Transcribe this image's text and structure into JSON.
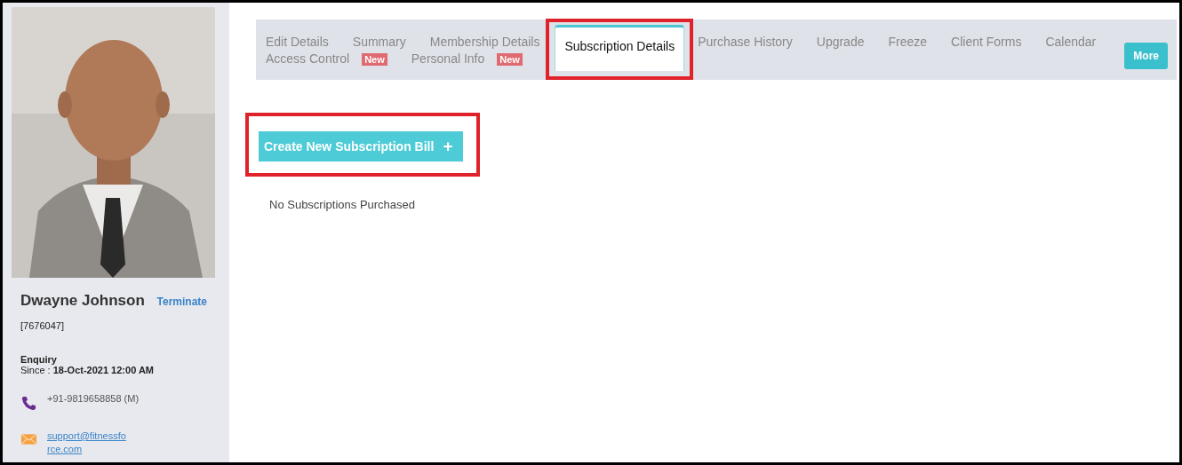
{
  "profile": {
    "name": "Dwayne Johnson",
    "action": "Terminate",
    "id": "[7676047]",
    "status": "Enquiry",
    "since_label": "Since : ",
    "since": "18-Oct-2021 12:00 AM",
    "phone": "+91-9819658858 (M)",
    "email": "support@fitnessfo rce.com"
  },
  "tabs": [
    {
      "label": "Edit Details",
      "selected": false,
      "highlighted": false
    },
    {
      "label": "Summary",
      "selected": false,
      "highlighted": false
    },
    {
      "label": "Membership Details",
      "selected": false,
      "highlighted": false
    },
    {
      "label": "Subscription Details",
      "selected": true,
      "highlighted": true
    },
    {
      "label": "Purchase History",
      "selected": false,
      "highlighted": false
    },
    {
      "label": "Upgrade",
      "selected": false,
      "highlighted": false
    },
    {
      "label": "Freeze",
      "selected": false,
      "highlighted": false
    },
    {
      "label": "Client Forms",
      "selected": false,
      "highlighted": false
    },
    {
      "label": "Calendar",
      "selected": false,
      "highlighted": false
    },
    {
      "label": "Access Control",
      "selected": false,
      "highlighted": false,
      "badge": "New"
    },
    {
      "label": "Personal Info",
      "selected": false,
      "highlighted": false,
      "badge": "New"
    }
  ],
  "more_button": "More",
  "create_button": {
    "label": "Create New Subscription Bill",
    "icon": "+",
    "highlighted": true
  },
  "empty_message": "No Subscriptions Purchased"
}
